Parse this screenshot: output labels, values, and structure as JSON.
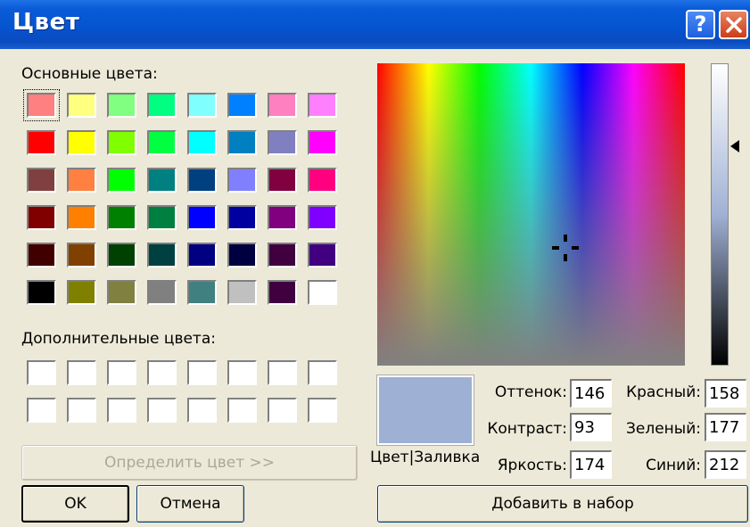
{
  "window": {
    "title": "Цвет"
  },
  "titlebar": {
    "help_label": "?"
  },
  "basic": {
    "label": "Основные цвета:",
    "colors": [
      [
        "#ff8080",
        "#ffff80",
        "#80ff80",
        "#00ff80",
        "#80ffff",
        "#0080ff",
        "#ff80c0",
        "#ff80ff"
      ],
      [
        "#ff0000",
        "#ffff00",
        "#80ff00",
        "#00ff40",
        "#00ffff",
        "#0080c0",
        "#8080c0",
        "#ff00ff"
      ],
      [
        "#804040",
        "#ff8040",
        "#00ff00",
        "#008080",
        "#004080",
        "#8080ff",
        "#800040",
        "#ff0080"
      ],
      [
        "#800000",
        "#ff8000",
        "#008000",
        "#008040",
        "#0000ff",
        "#0000a0",
        "#800080",
        "#8000ff"
      ],
      [
        "#400000",
        "#804000",
        "#004000",
        "#004040",
        "#000080",
        "#000040",
        "#400040",
        "#400080"
      ],
      [
        "#000000",
        "#808000",
        "#808040",
        "#808080",
        "#408080",
        "#c0c0c0",
        "#400040",
        "#ffffff"
      ]
    ]
  },
  "custom": {
    "label": "Дополнительные цвета:"
  },
  "define_button": "Определить цвет >>",
  "ok_button": "OK",
  "cancel_button": "Отмена",
  "preview_label": "Цвет|Заливка",
  "preview_color": "#9eb1d4",
  "hue": {
    "label": "Оттенок:",
    "value": "146"
  },
  "sat": {
    "label": "Контраст:",
    "value": "93"
  },
  "lum": {
    "label": "Яркость:",
    "value": "174"
  },
  "red": {
    "label": "Красный:",
    "value": "158"
  },
  "green": {
    "label": "Зеленый:",
    "value": "177"
  },
  "blue": {
    "label": "Синий:",
    "value": "212"
  },
  "add_button": "Добавить в набор"
}
